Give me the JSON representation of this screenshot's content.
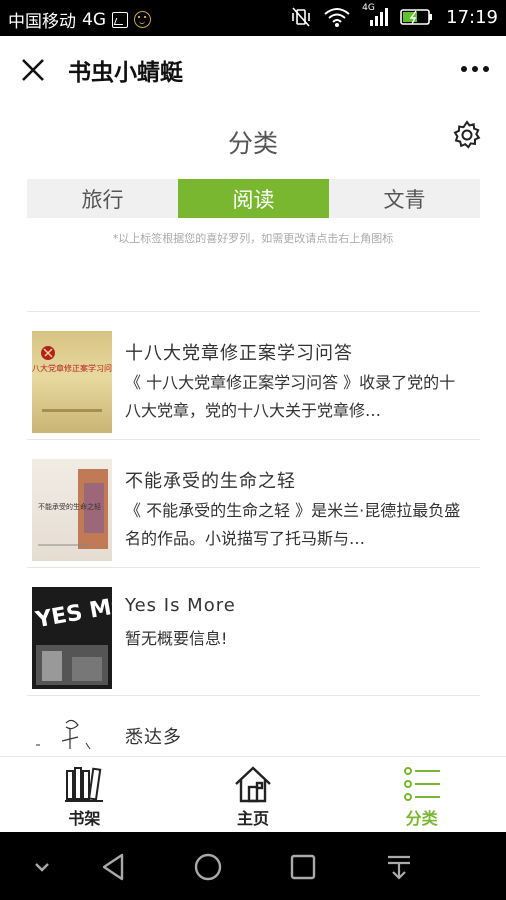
{
  "status_bar": {
    "carrier": "中国移动",
    "network": "4G",
    "network_small": "4G",
    "time": "17:19"
  },
  "title_bar": {
    "title": "书虫小蜻蜓"
  },
  "category": {
    "title": "分类",
    "tabs": [
      {
        "label": "旅行",
        "active": false
      },
      {
        "label": "阅读",
        "active": true
      },
      {
        "label": "文青",
        "active": false
      }
    ],
    "hint": "*以上标签根据您的喜好罗列，如需更改请点击右上角图标"
  },
  "books": [
    {
      "title": "十八大党章修正案学习问答",
      "description": "《 十八大党章修正案学习问答 》收录了党的十八大党章，党的十八大关于党章修…",
      "cover_text": "十八大党章修正案学习问答"
    },
    {
      "title": "不能承受的生命之轻",
      "description": "《 不能承受的生命之轻 》是米兰·昆德拉最负盛名的作品。小说描写了托马斯与…",
      "cover_text": "不能承受的生命之轻"
    },
    {
      "title": "Yes Is More",
      "description": "暂无概要信息!",
      "cover_text": "YES MORE"
    },
    {
      "title": "悉达多",
      "description": ""
    }
  ],
  "bottom_nav": [
    {
      "label": "书架",
      "icon": "bookshelf-icon",
      "active": false
    },
    {
      "label": "主页",
      "icon": "home-icon",
      "active": false
    },
    {
      "label": "分类",
      "icon": "category-list-icon",
      "active": true
    }
  ],
  "colors": {
    "accent": "#78b72f",
    "status_bar": "#000000"
  }
}
